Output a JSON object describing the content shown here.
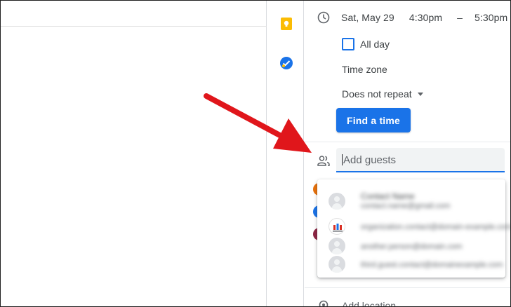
{
  "event": {
    "date": "Sat, May 29",
    "start_time": "4:30pm",
    "dash": "–",
    "end_time": "5:30pm"
  },
  "all_day_label": "All day",
  "time_zone_label": "Time zone",
  "repeat_label": "Does not repeat",
  "find_time_label": "Find a time",
  "guests": {
    "placeholder": "Add guests"
  },
  "suggestions": [
    {
      "name": "Contact Name",
      "email": "contact.name@gmail.com"
    },
    {
      "name": "",
      "email": "organization.contact@domain-example.com"
    },
    {
      "name": "",
      "email": "another.person@domain.com"
    },
    {
      "name": "",
      "email": "third.guest.contact@domainexample.com"
    }
  ],
  "location_label": "Add location",
  "colors": {
    "accent": "#1a73e8",
    "arrow": "#e0161b",
    "keep": "#fbbc04"
  }
}
